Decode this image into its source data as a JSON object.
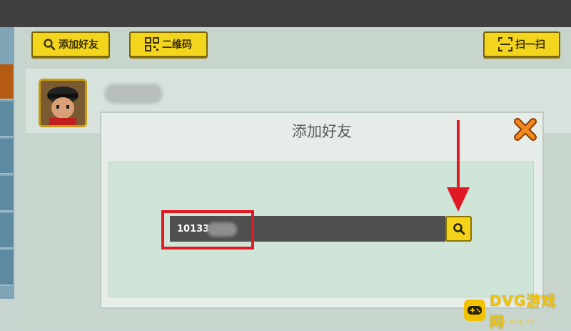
{
  "toolbar": {
    "add_friend_label": "添加好友",
    "qr_code_label": "二维码",
    "scan_label": "扫一扫"
  },
  "dialog": {
    "title": "添加好友",
    "search_value": "10133",
    "icons": {
      "close": "close-x-icon",
      "search": "magnifier-icon"
    }
  },
  "watermark": {
    "text": "DVG游戏网",
    "sub": "www.dvg.cn"
  },
  "colors": {
    "accent_yellow": "#f4d51d",
    "highlight_red": "#e11924",
    "close_orange": "#f08a1c",
    "topbar": "#3f403f"
  }
}
